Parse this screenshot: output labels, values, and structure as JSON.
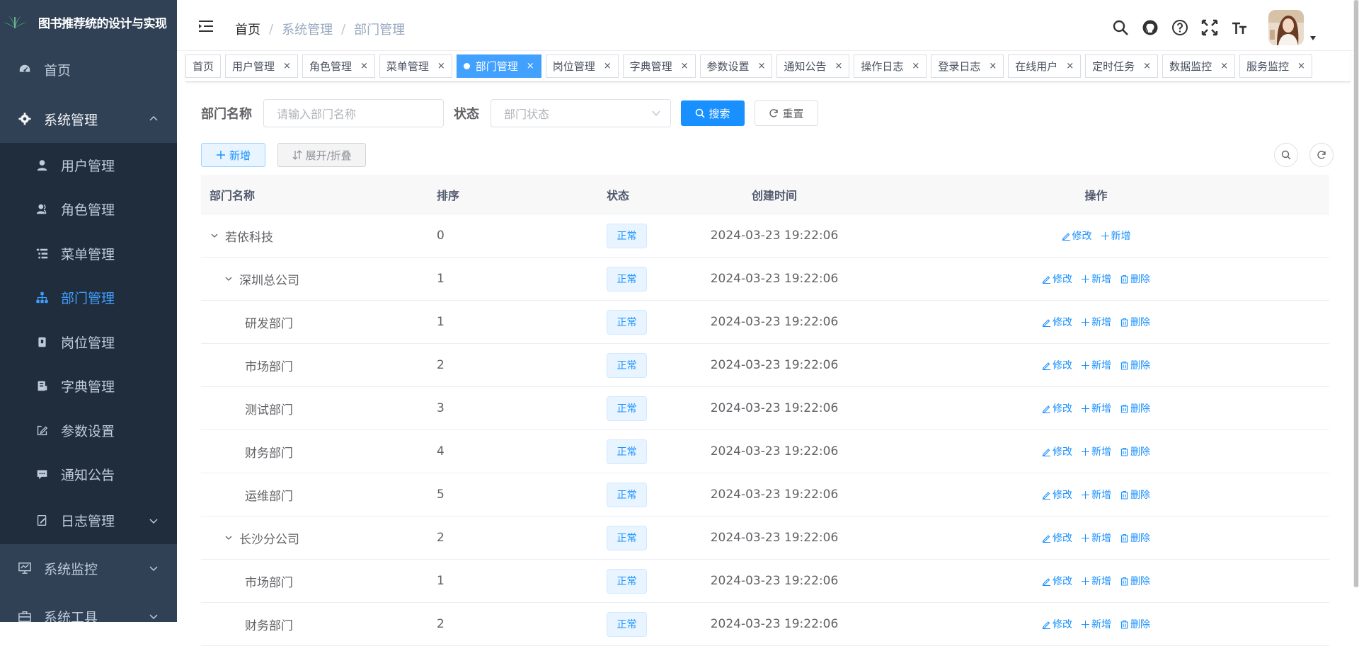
{
  "app": {
    "title": "图书推荐统的设计与实现"
  },
  "sidebar": {
    "items": [
      {
        "label": "首页",
        "icon": "dashboard-icon"
      },
      {
        "label": "系统管理",
        "icon": "gear-icon",
        "expanded": true
      },
      {
        "label": "系统监控",
        "icon": "monitor-icon"
      },
      {
        "label": "系统工具",
        "icon": "toolbox-icon"
      }
    ],
    "sub": [
      {
        "label": "用户管理",
        "icon": "user-icon"
      },
      {
        "label": "角色管理",
        "icon": "peoples-icon"
      },
      {
        "label": "菜单管理",
        "icon": "tree-table-icon"
      },
      {
        "label": "部门管理",
        "icon": "tree-icon",
        "active": true
      },
      {
        "label": "岗位管理",
        "icon": "post-icon"
      },
      {
        "label": "字典管理",
        "icon": "dict-icon"
      },
      {
        "label": "参数设置",
        "icon": "edit-icon"
      },
      {
        "label": "通知公告",
        "icon": "message-icon"
      },
      {
        "label": "日志管理",
        "icon": "log-icon"
      }
    ]
  },
  "breadcrumb": [
    "首页",
    "系统管理",
    "部门管理"
  ],
  "tags": [
    {
      "label": "首页",
      "closable": false
    },
    {
      "label": "用户管理",
      "closable": true
    },
    {
      "label": "角色管理",
      "closable": true
    },
    {
      "label": "菜单管理",
      "closable": true
    },
    {
      "label": "部门管理",
      "closable": true,
      "active": true
    },
    {
      "label": "岗位管理",
      "closable": true
    },
    {
      "label": "字典管理",
      "closable": true
    },
    {
      "label": "参数设置",
      "closable": true
    },
    {
      "label": "通知公告",
      "closable": true
    },
    {
      "label": "操作日志",
      "closable": true
    },
    {
      "label": "登录日志",
      "closable": true
    },
    {
      "label": "在线用户",
      "closable": true
    },
    {
      "label": "定时任务",
      "closable": true
    },
    {
      "label": "数据监控",
      "closable": true
    },
    {
      "label": "服务监控",
      "closable": true
    }
  ],
  "tag_close": "×",
  "search": {
    "dept_label": "部门名称",
    "dept_placeholder": "请输入部门名称",
    "status_label": "状态",
    "status_placeholder": "部门状态",
    "search_btn": "搜索",
    "reset_btn": "重置"
  },
  "toolbar": {
    "add_btn": "新增",
    "expand_btn": "展开/折叠"
  },
  "table": {
    "headers": {
      "name": "部门名称",
      "order": "排序",
      "status": "状态",
      "time": "创建时间",
      "ops": "操作"
    },
    "ops": {
      "edit": "修改",
      "add": "新增",
      "delete": "删除"
    },
    "rows": [
      {
        "name": "若依科技",
        "order": "0",
        "status": "正常",
        "time": "2024-03-23 19:22:06",
        "level": 0,
        "expandable": true,
        "deletable": false
      },
      {
        "name": "深圳总公司",
        "order": "1",
        "status": "正常",
        "time": "2024-03-23 19:22:06",
        "level": 1,
        "expandable": true,
        "deletable": true
      },
      {
        "name": "研发部门",
        "order": "1",
        "status": "正常",
        "time": "2024-03-23 19:22:06",
        "level": 2,
        "expandable": false,
        "deletable": true
      },
      {
        "name": "市场部门",
        "order": "2",
        "status": "正常",
        "time": "2024-03-23 19:22:06",
        "level": 2,
        "expandable": false,
        "deletable": true
      },
      {
        "name": "测试部门",
        "order": "3",
        "status": "正常",
        "time": "2024-03-23 19:22:06",
        "level": 2,
        "expandable": false,
        "deletable": true
      },
      {
        "name": "财务部门",
        "order": "4",
        "status": "正常",
        "time": "2024-03-23 19:22:06",
        "level": 2,
        "expandable": false,
        "deletable": true
      },
      {
        "name": "运维部门",
        "order": "5",
        "status": "正常",
        "time": "2024-03-23 19:22:06",
        "level": 2,
        "expandable": false,
        "deletable": true
      },
      {
        "name": "长沙分公司",
        "order": "2",
        "status": "正常",
        "time": "2024-03-23 19:22:06",
        "level": 1,
        "expandable": true,
        "deletable": true
      },
      {
        "name": "市场部门",
        "order": "1",
        "status": "正常",
        "time": "2024-03-23 19:22:06",
        "level": 2,
        "expandable": false,
        "deletable": true
      },
      {
        "name": "财务部门",
        "order": "2",
        "status": "正常",
        "time": "2024-03-23 19:22:06",
        "level": 2,
        "expandable": false,
        "deletable": true
      }
    ]
  },
  "colors": {
    "sidebar_bg": "#304156",
    "submenu_bg": "#1f2d3d",
    "primary": "#1890ff",
    "active_menu": "#409eff"
  }
}
